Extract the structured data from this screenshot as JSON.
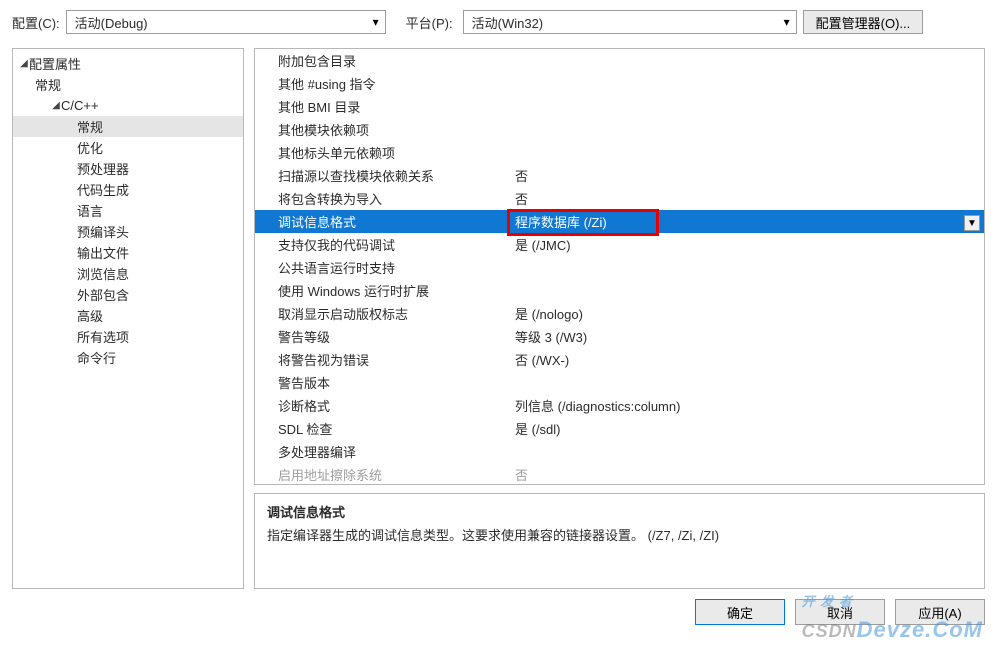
{
  "top": {
    "config_label": "配置(C):",
    "config_value": "活动(Debug)",
    "platform_label": "平台(P):",
    "platform_value": "活动(Win32)",
    "config_manager": "配置管理器(O)..."
  },
  "tree": {
    "root": "配置属性",
    "general": "常规",
    "cc": "C/C++",
    "children": [
      "常规",
      "优化",
      "预处理器",
      "代码生成",
      "语言",
      "预编译头",
      "输出文件",
      "浏览信息",
      "外部包含",
      "高级",
      "所有选项",
      "命令行"
    ]
  },
  "props": [
    {
      "name": "附加包含目录",
      "val": ""
    },
    {
      "name": "其他 #using 指令",
      "val": ""
    },
    {
      "name": "其他 BMI 目录",
      "val": ""
    },
    {
      "name": "其他模块依赖项",
      "val": ""
    },
    {
      "name": "其他标头单元依赖项",
      "val": ""
    },
    {
      "name": "扫描源以查找模块依赖关系",
      "val": "否"
    },
    {
      "name": "将包含转换为导入",
      "val": "否"
    },
    {
      "name": "调试信息格式",
      "val": "程序数据库 (/Zi)",
      "selected": true,
      "highlight": true
    },
    {
      "name": "支持仅我的代码调试",
      "val": "是 (/JMC)"
    },
    {
      "name": "公共语言运行时支持",
      "val": ""
    },
    {
      "name": "使用 Windows 运行时扩展",
      "val": ""
    },
    {
      "name": "取消显示启动版权标志",
      "val": "是 (/nologo)"
    },
    {
      "name": "警告等级",
      "val": "等级 3 (/W3)"
    },
    {
      "name": "将警告视为错误",
      "val": "否 (/WX-)"
    },
    {
      "name": "警告版本",
      "val": ""
    },
    {
      "name": "诊断格式",
      "val": "列信息 (/diagnostics:column)"
    },
    {
      "name": "SDL 检查",
      "val": "是 (/sdl)"
    },
    {
      "name": "多处理器编译",
      "val": ""
    },
    {
      "name": "启用地址擦除系统",
      "val": "否",
      "disabled": true
    }
  ],
  "desc": {
    "title": "调试信息格式",
    "body": "指定编译器生成的调试信息类型。这要求使用兼容的链接器设置。    (/Z7, /Zi, /ZI)"
  },
  "buttons": {
    "ok": "确定",
    "cancel": "取消",
    "apply": "应用(A)"
  },
  "watermark": {
    "a": "开 发 者",
    "b": "Devze.CoM",
    "c": "CSDN"
  }
}
